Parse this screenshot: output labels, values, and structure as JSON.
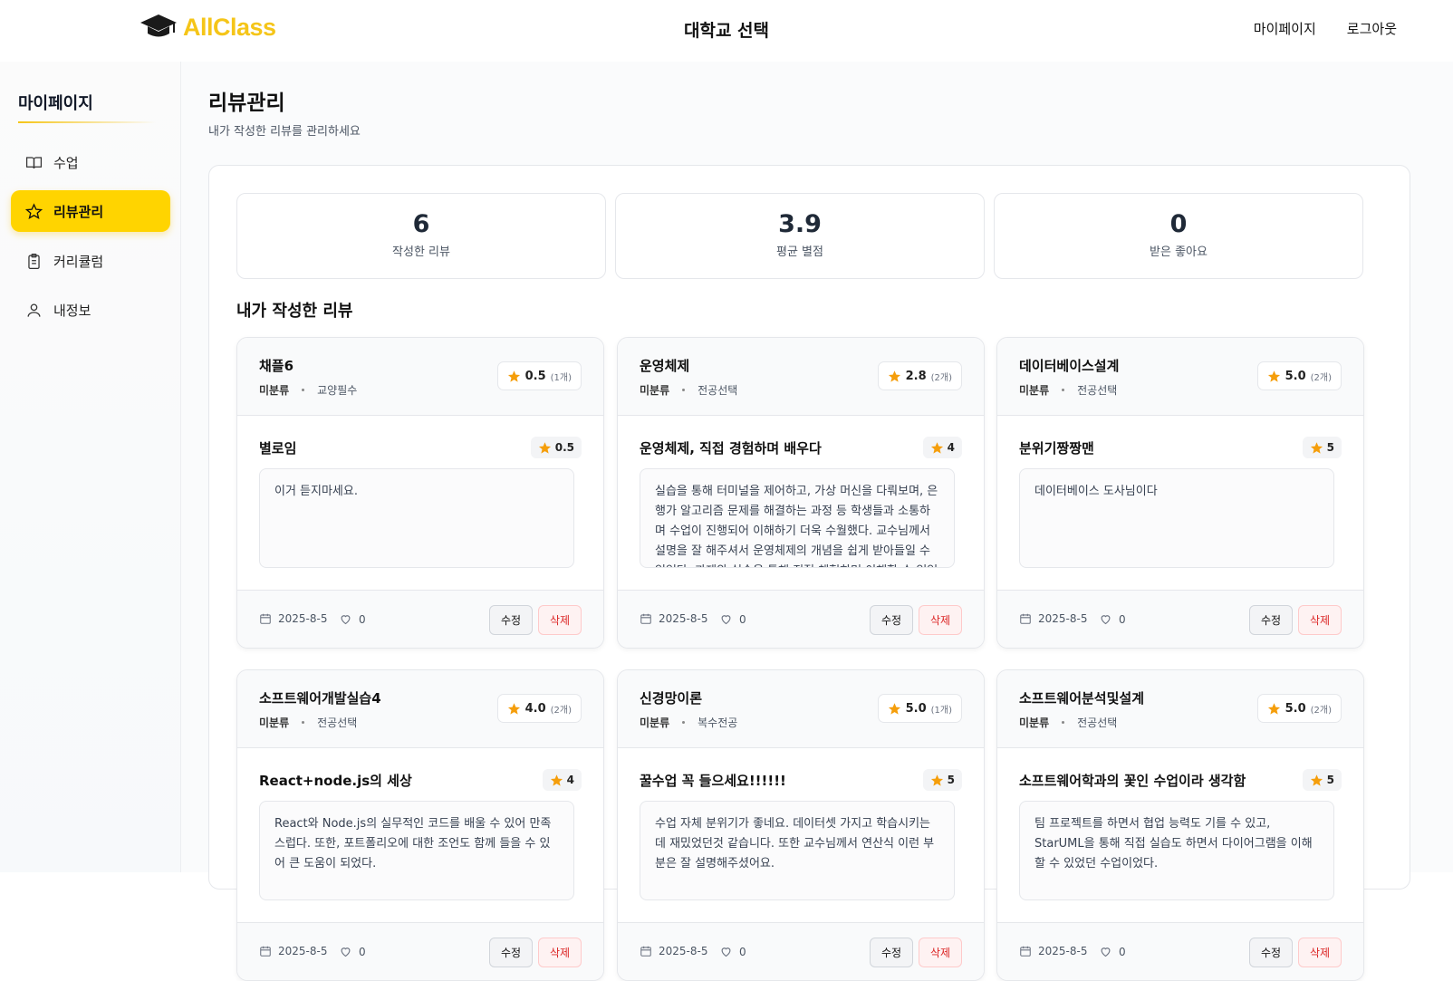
{
  "header": {
    "brand": "AllClass",
    "center_title": "대학교 선택",
    "nav": {
      "mypage": "마이페이지",
      "logout": "로그아웃"
    }
  },
  "sidebar": {
    "title": "마이페이지",
    "items": [
      {
        "label": "수업",
        "icon": "book-icon"
      },
      {
        "label": "리뷰관리",
        "icon": "star-icon"
      },
      {
        "label": "커리큘럼",
        "icon": "clipboard-icon"
      },
      {
        "label": "내정보",
        "icon": "user-icon"
      }
    ]
  },
  "page": {
    "title": "리뷰관리",
    "subtitle": "내가 작성한 리뷰를 관리하세요"
  },
  "stats": [
    {
      "value": "6",
      "label": "작성한 리뷰"
    },
    {
      "value": "3.9",
      "label": "평균 별점"
    },
    {
      "value": "0",
      "label": "받은 좋아요"
    }
  ],
  "section_title": "내가 작성한 리뷰",
  "colors": {
    "accent": "#ffd400",
    "star": "#f59e0b",
    "delete": "#dc2626"
  },
  "labels": {
    "edit": "수정",
    "delete": "삭제"
  },
  "reviews": [
    {
      "course": "채플6",
      "category": "미분류",
      "type": "교양필수",
      "avg": "0.5",
      "count": "(1개)",
      "title": "별로임",
      "score": "0.5",
      "content": "이거 듣지마세요.",
      "date": "2025-8-5",
      "likes": "0"
    },
    {
      "course": "운영체제",
      "category": "미분류",
      "type": "전공선택",
      "avg": "2.8",
      "count": "(2개)",
      "title": "운영체제, 직접 경험하며 배우다",
      "score": "4",
      "content": "실습을 통해 터미널을 제어하고, 가상 머신을 다뤄보며, 은행가 알고리즘 문제를 해결하는 과정 등 학생들과 소통하며 수업이 진행되어 이해하기 더욱 수월했다. 교수님께서 설명을 잘 해주셔서 운영체제의 개념을 쉽게 받아들일 수 있었다. 과제와 실습을 통해 직접 체험하며 이해할 수 있었다.",
      "date": "2025-8-5",
      "likes": "0"
    },
    {
      "course": "데이터베이스설계",
      "category": "미분류",
      "type": "전공선택",
      "avg": "5.0",
      "count": "(2개)",
      "title": "분위기짱짱맨",
      "score": "5",
      "content": "데이터베이스 도사님이다",
      "date": "2025-8-5",
      "likes": "0"
    },
    {
      "course": "소프트웨어개발실습4",
      "category": "미분류",
      "type": "전공선택",
      "avg": "4.0",
      "count": "(2개)",
      "title": "React+node.js의 세상",
      "score": "4",
      "content": "React와 Node.js의 실무적인 코드를 배울 수 있어 만족스럽다. 또한, 포트폴리오에 대한 조언도 함께 들을 수 있어 큰 도움이 되었다.",
      "date": "2025-8-5",
      "likes": "0"
    },
    {
      "course": "신경망이론",
      "category": "미분류",
      "type": "복수전공",
      "avg": "5.0",
      "count": "(1개)",
      "title": "꿀수업 꼭 들으세요!!!!!!",
      "score": "5",
      "content": "수업 자체 분위기가 좋네요. 데이터셋 가지고 학습시키는데 재밌었던것 같습니다. 또한 교수님께서 연산식 이런 부분은 잘 설명해주셨어요.",
      "date": "2025-8-5",
      "likes": "0"
    },
    {
      "course": "소프트웨어분석및설계",
      "category": "미분류",
      "type": "전공선택",
      "avg": "5.0",
      "count": "(2개)",
      "title": "소프트웨어학과의 꽃인 수업이라 생각함",
      "score": "5",
      "content": "팀 프로젝트를 하면서 협업 능력도 기를 수 있고, StarUML을 통해 직접 실습도 하면서 다이어그램을 이해할 수 있었던 수업이었다.",
      "date": "2025-8-5",
      "likes": "0"
    }
  ]
}
